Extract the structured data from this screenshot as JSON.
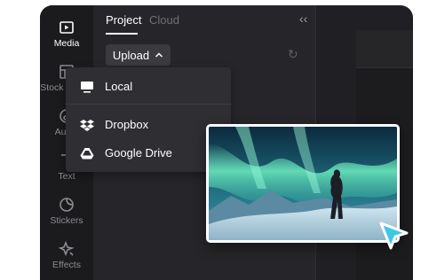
{
  "sidebar": {
    "items": [
      {
        "label": "Media",
        "icon": "media-icon",
        "active": true
      },
      {
        "label": "Stock videos",
        "icon": "stock-videos-icon",
        "active": false
      },
      {
        "label": "Audio",
        "icon": "audio-icon",
        "active": false
      },
      {
        "label": "Text",
        "icon": "text-icon",
        "active": false
      },
      {
        "label": "Stickers",
        "icon": "stickers-icon",
        "active": false
      },
      {
        "label": "Effects",
        "icon": "effects-icon",
        "active": false
      }
    ]
  },
  "tabs": [
    {
      "label": "Project",
      "active": true
    },
    {
      "label": "Cloud",
      "active": false
    }
  ],
  "collapse_icon": "double-chevron-left-icon",
  "upload": {
    "label": "Upload",
    "icon": "chevron-up-icon"
  },
  "refresh_icon": "refresh-icon",
  "dropdown": {
    "items": [
      {
        "label": "Local",
        "icon": "monitor-icon"
      },
      {
        "label": "Dropbox",
        "icon": "dropbox-icon"
      },
      {
        "label": "Google Drive",
        "icon": "google-drive-icon"
      }
    ]
  },
  "preview": {
    "subject": "aurora-photo"
  },
  "cursor_icon": "pointer-cursor-icon",
  "colors": {
    "accent_cyan": "#3ec7e6",
    "panel_bg": "#26262a",
    "rail_bg": "#1b1b1e"
  }
}
